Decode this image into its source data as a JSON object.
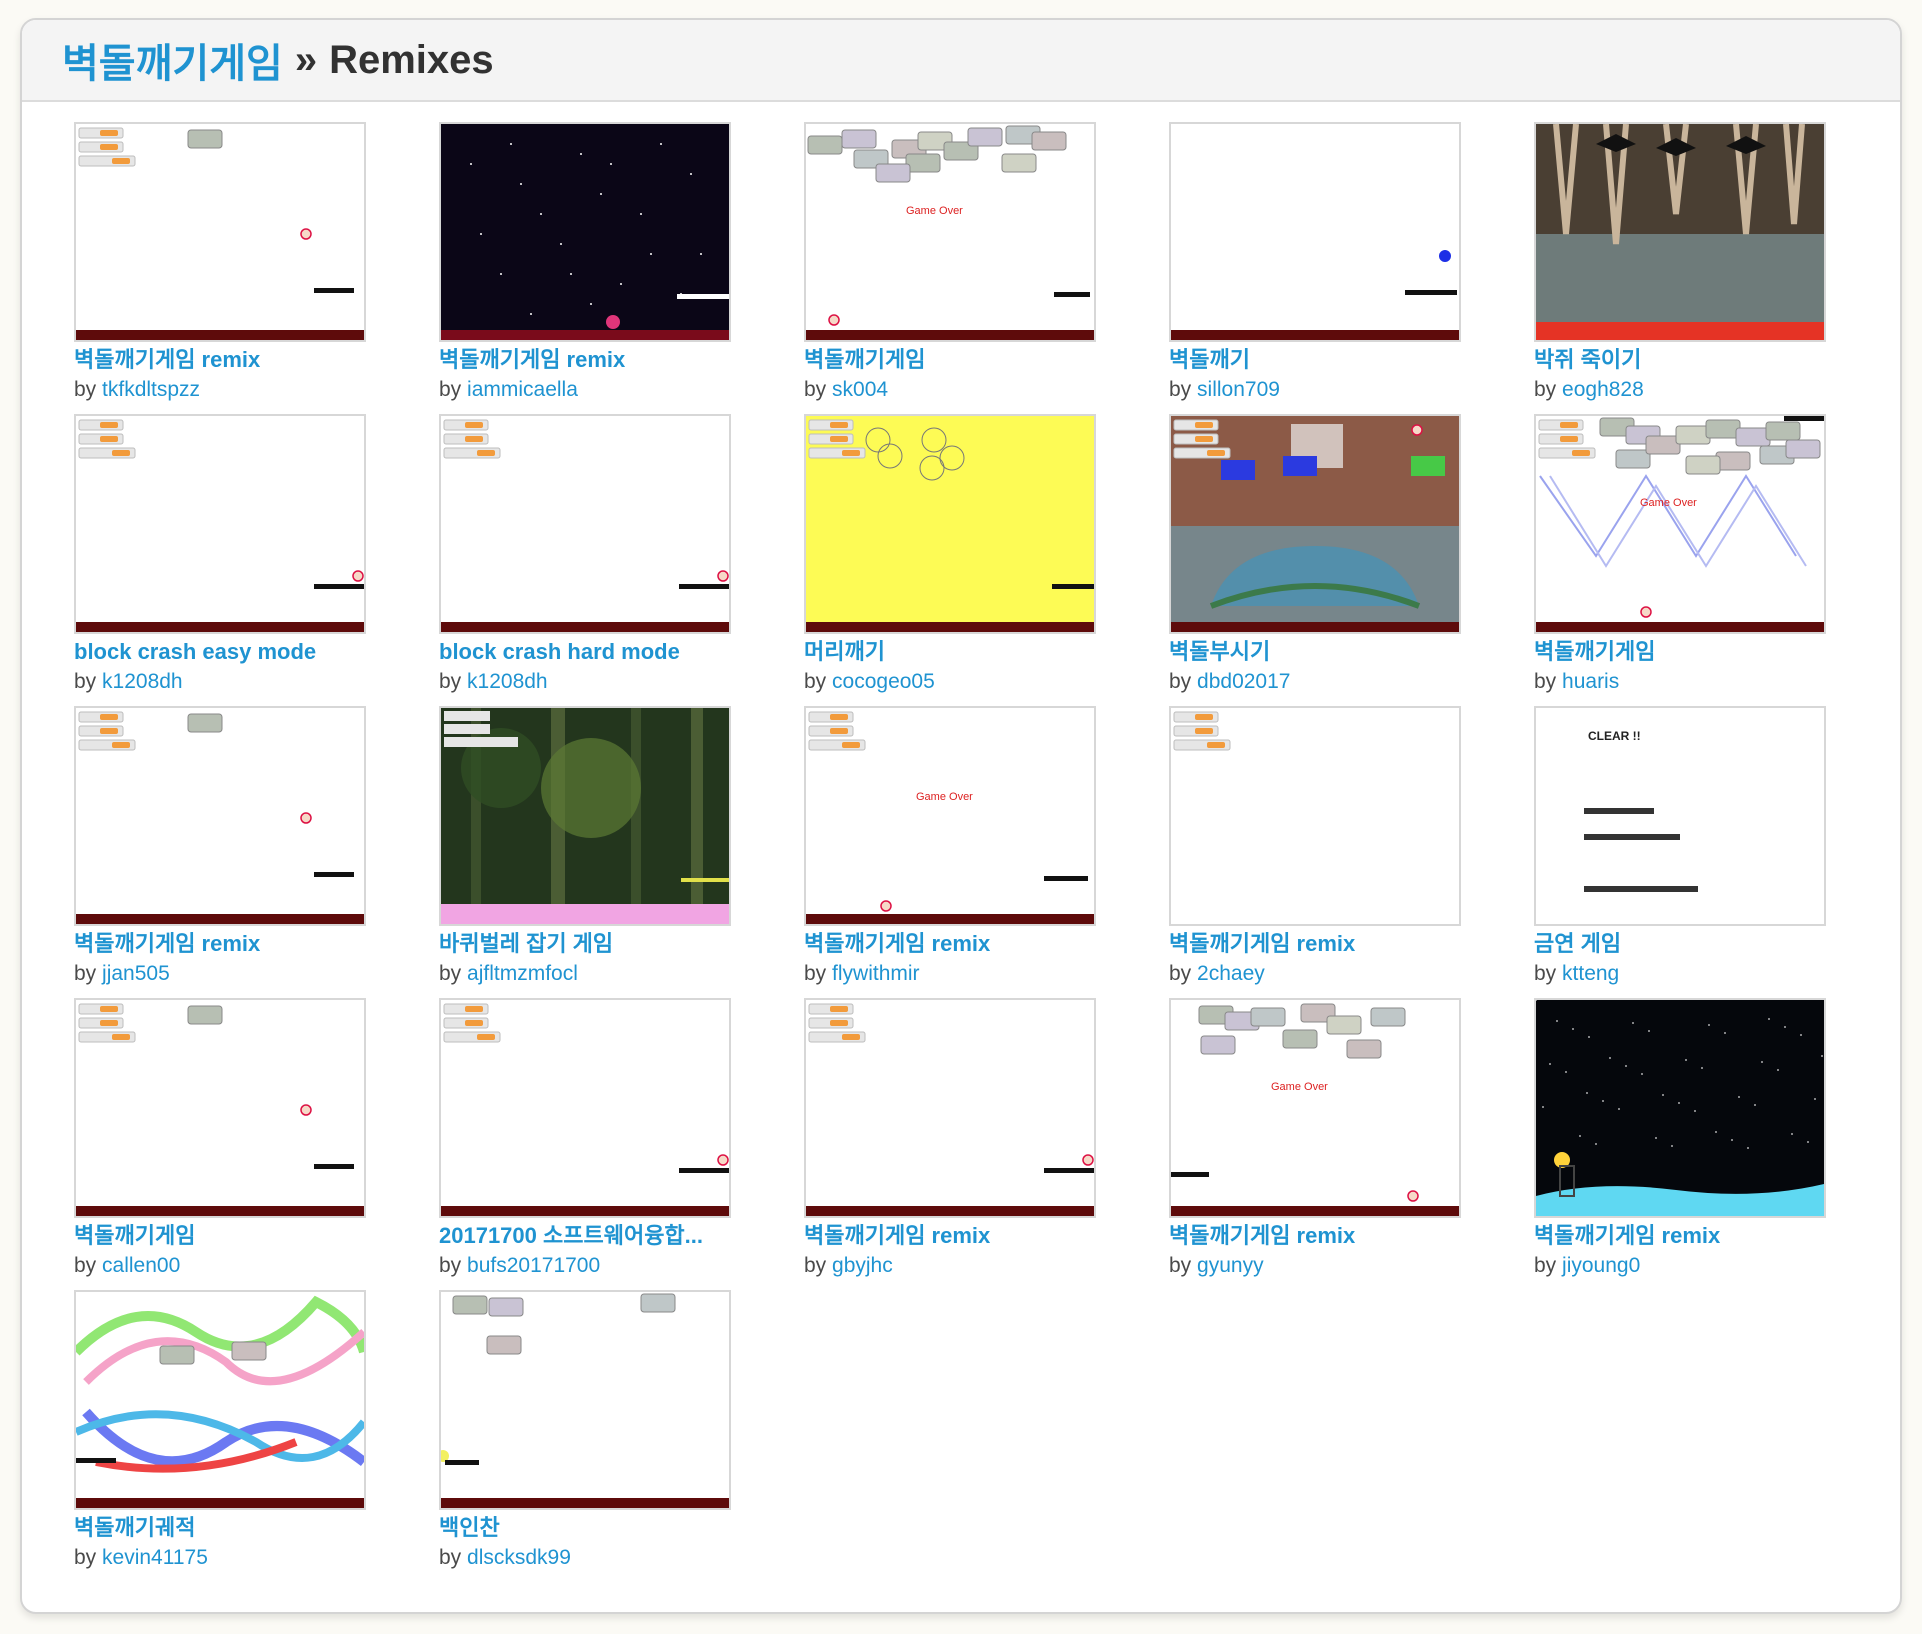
{
  "header": {
    "project_title": "벽돌깨기게임",
    "separator": "»",
    "section": "Remixes"
  },
  "remixes": [
    {
      "title": "벽돌깨기게임 remix",
      "by": "by",
      "author": "tkfkdltspzz",
      "thumb": "white-ball"
    },
    {
      "title": "벽돌깨기게임 remix",
      "by": "by",
      "author": "iammicaella",
      "thumb": "space"
    },
    {
      "title": "벽돌깨기게임",
      "by": "by",
      "author": "sk004",
      "thumb": "bricks-gameover"
    },
    {
      "title": "벽돌깨기",
      "by": "by",
      "author": "sillon709",
      "thumb": "blue-ball"
    },
    {
      "title": "박쥐 죽이기",
      "by": "by",
      "author": "eogh828",
      "thumb": "cave"
    },
    {
      "title": "block crash easy mode",
      "by": "by",
      "author": "k1208dh",
      "thumb": "white-paddle"
    },
    {
      "title": "block crash hard mode",
      "by": "by",
      "author": "k1208dh",
      "thumb": "white-paddle"
    },
    {
      "title": "머리깨기",
      "by": "by",
      "author": "cocogeo05",
      "thumb": "yellow"
    },
    {
      "title": "벽돌부시기",
      "by": "by",
      "author": "dbd02017",
      "thumb": "court"
    },
    {
      "title": "벽돌깨기게임",
      "by": "by",
      "author": "huaris",
      "thumb": "zigzag"
    },
    {
      "title": "벽돌깨기게임 remix",
      "by": "by",
      "author": "jjan505",
      "thumb": "white-ball"
    },
    {
      "title": "바퀴벌레 잡기 게임",
      "by": "by",
      "author": "ajfltmzmfocl",
      "thumb": "forest"
    },
    {
      "title": "벽돌깨기게임 remix",
      "by": "by",
      "author": "flywithmir",
      "thumb": "white-gameover"
    },
    {
      "title": "벽돌깨기게임 remix",
      "by": "by",
      "author": "2chaey",
      "thumb": "white-vars"
    },
    {
      "title": "금연 게임",
      "by": "by",
      "author": "ktteng",
      "thumb": "clear"
    },
    {
      "title": "벽돌깨기게임",
      "by": "by",
      "author": "callen00",
      "thumb": "white-ball"
    },
    {
      "title": "20171700 소프트웨어융합...",
      "by": "by",
      "author": "bufs20171700",
      "thumb": "white-paddle"
    },
    {
      "title": "벽돌깨기게임 remix",
      "by": "by",
      "author": "gbyjhc",
      "thumb": "white-paddle"
    },
    {
      "title": "벽돌깨기게임 remix",
      "by": "by",
      "author": "gyunyy",
      "thumb": "bricks-gameover2"
    },
    {
      "title": "벽돌깨기게임 remix",
      "by": "by",
      "author": "jiyoung0",
      "thumb": "night"
    },
    {
      "title": "벽돌깨기궤적",
      "by": "by",
      "author": "kevin41175",
      "thumb": "trails"
    },
    {
      "title": "백인찬",
      "by": "by",
      "author": "dlscksdk99",
      "thumb": "few-bricks"
    }
  ],
  "thumb_text": {
    "game_over": "Game Over",
    "clear_title": "CLEAR !!"
  },
  "colors": {
    "link": "#1f93d1",
    "floor": "#5e0b0b",
    "header_bg": "#f4f4f4"
  }
}
